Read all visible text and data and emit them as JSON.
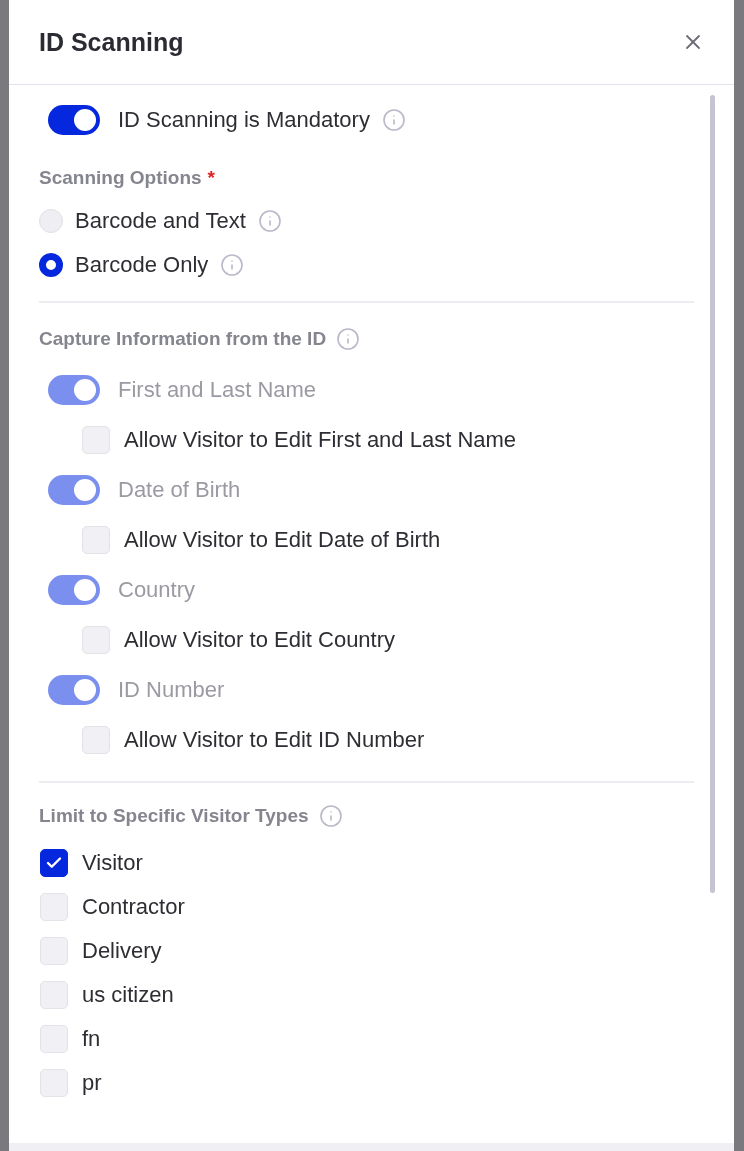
{
  "dialog": {
    "title": "ID Scanning"
  },
  "mandatory": {
    "label": "ID Scanning is Mandatory",
    "on": true,
    "disabled": false
  },
  "scanning_options": {
    "title": "Scanning Options",
    "required_mark": "*",
    "options": [
      {
        "label": "Barcode and Text",
        "selected": false
      },
      {
        "label": "Barcode Only",
        "selected": true
      }
    ]
  },
  "capture": {
    "title": "Capture Information from the ID",
    "fields": [
      {
        "label": "First and Last Name",
        "on": true,
        "disabled": true,
        "edit": {
          "label": "Allow Visitor to Edit First and Last Name",
          "checked": false
        }
      },
      {
        "label": "Date of Birth",
        "on": true,
        "disabled": true,
        "edit": {
          "label": "Allow Visitor to Edit Date of Birth",
          "checked": false
        }
      },
      {
        "label": "Country",
        "on": true,
        "disabled": true,
        "edit": {
          "label": "Allow Visitor to Edit Country",
          "checked": false
        }
      },
      {
        "label": "ID Number",
        "on": true,
        "disabled": true,
        "edit": {
          "label": "Allow Visitor to Edit ID Number",
          "checked": false
        }
      }
    ]
  },
  "visitor_types": {
    "title": "Limit to Specific Visitor Types",
    "items": [
      {
        "label": "Visitor",
        "checked": true
      },
      {
        "label": "Contractor",
        "checked": false
      },
      {
        "label": "Delivery",
        "checked": false
      },
      {
        "label": "us citizen",
        "checked": false
      },
      {
        "label": "fn",
        "checked": false
      },
      {
        "label": "pr",
        "checked": false
      }
    ]
  }
}
